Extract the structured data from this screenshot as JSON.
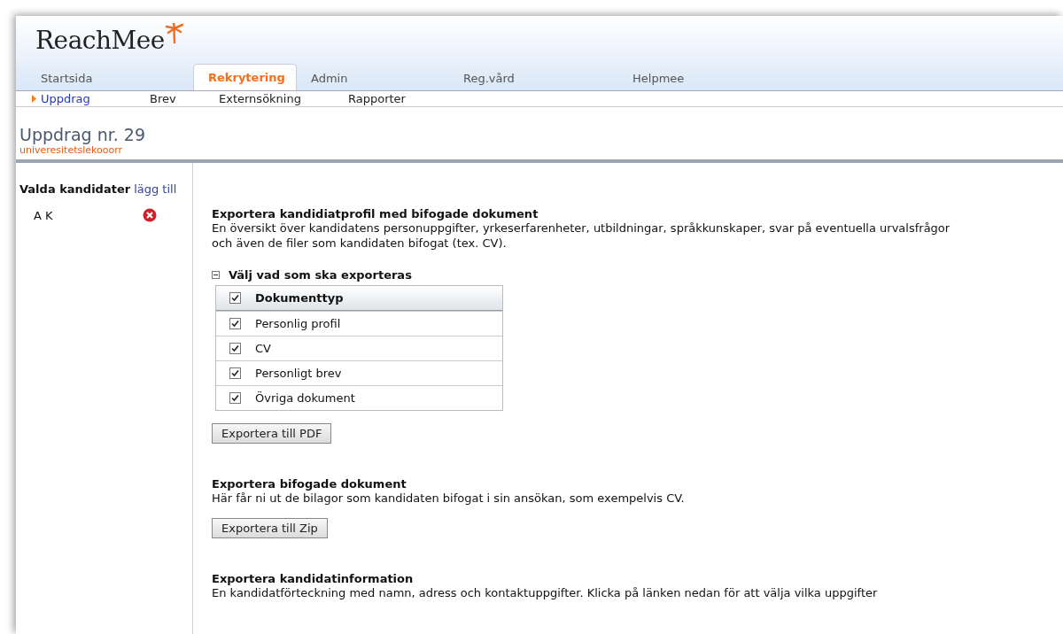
{
  "logo": "ReachMee",
  "tabs": [
    {
      "label": "Startsida",
      "selected": false
    },
    {
      "label": "Rekrytering",
      "selected": true
    },
    {
      "label": "Admin",
      "selected": false
    },
    {
      "label": "Reg.vård",
      "selected": false
    },
    {
      "label": "Helpmee",
      "selected": false
    }
  ],
  "subnav": [
    {
      "label": "Uppdrag",
      "selected": true
    },
    {
      "label": "Brev",
      "selected": false
    },
    {
      "label": "Externsökning",
      "selected": false
    },
    {
      "label": "Rapporter",
      "selected": false
    }
  ],
  "page_title": "Uppdrag nr. 29",
  "page_subtitle": "univeresitetslekooorr",
  "sidebar": {
    "heading": "Valda kandidater",
    "add_link": "lägg till",
    "candidates": [
      {
        "name": "A K"
      }
    ]
  },
  "sections": [
    {
      "kind": "table",
      "title": "Exportera kandidiatprofil med bifogade dokument",
      "description": "En översikt över kandidatens personuppgifter, yrkeserfarenheter, utbildningar, språkkunskaper, svar på eventuella urvalsfrågor och även de filer som kandidaten bifogat (tex. CV).",
      "group": {
        "label": "Välj vad som ska exporteras",
        "expanded": true
      },
      "table": {
        "column": "Dokumenttyp",
        "all_checked": true,
        "rows": [
          {
            "label": "Personlig profil",
            "checked": true
          },
          {
            "label": "CV",
            "checked": true
          },
          {
            "label": "Personligt brev",
            "checked": true
          },
          {
            "label": "Övriga dokument",
            "checked": true
          }
        ]
      },
      "button": "Exportera till PDF"
    },
    {
      "kind": "button",
      "title": "Exportera bifogade dokument",
      "description": "Här får ni ut de bilagor som kandidaten bifogat i sin ansökan, som exempelvis CV.",
      "button": "Exportera till Zip"
    },
    {
      "kind": "text",
      "title": "Exportera kandidatinformation",
      "description": "En kandidatförteckning med namn, adress och kontaktuppgifter. Klicka på länken nedan för att välja vilka uppgifter"
    }
  ]
}
